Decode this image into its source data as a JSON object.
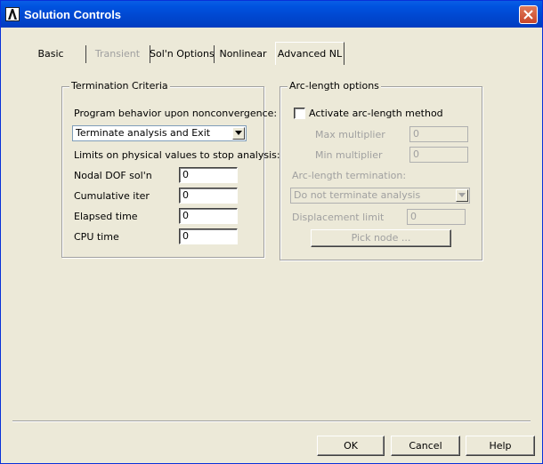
{
  "window": {
    "title": "Solution Controls"
  },
  "tabs": [
    {
      "label": "Basic",
      "state": "normal"
    },
    {
      "label": "Transient",
      "state": "disabled"
    },
    {
      "label": "Sol'n Options",
      "state": "normal"
    },
    {
      "label": "Nonlinear",
      "state": "normal"
    },
    {
      "label": "Advanced NL",
      "state": "active"
    }
  ],
  "termination": {
    "legend": "Termination Criteria",
    "behavior_label": "Program behavior upon nonconvergence:",
    "behavior_value": "Terminate analysis and Exit",
    "limits_label": "Limits on physical values to stop analysis:",
    "fields": [
      {
        "label": "Nodal DOF sol'n",
        "value": "0"
      },
      {
        "label": "Cumulative iter",
        "value": "0"
      },
      {
        "label": "Elapsed time",
        "value": "0"
      },
      {
        "label": "CPU time",
        "value": "0"
      }
    ]
  },
  "arclength": {
    "legend": "Arc-length options",
    "activate_label": "Activate arc-length method",
    "activate_checked": false,
    "max_label": "Max multiplier",
    "max_value": "0",
    "min_label": "Min multiplier",
    "min_value": "0",
    "termination_label": "Arc-length termination:",
    "termination_value": "Do not terminate analysis",
    "displacement_label": "Displacement limit",
    "displacement_value": "0",
    "pick_node_label": "Pick node ..."
  },
  "buttons": {
    "ok": "OK",
    "cancel": "Cancel",
    "help": "Help"
  },
  "colors": {
    "titlebar": "#0054e3",
    "face": "#ece9d8",
    "disabled_text": "#a0a0a0"
  }
}
